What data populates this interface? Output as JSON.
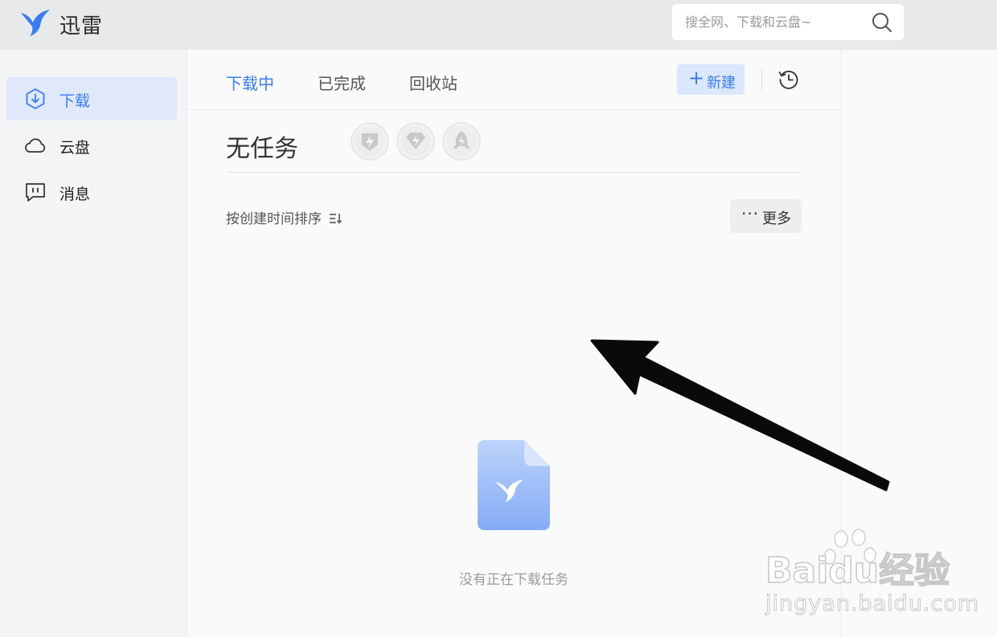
{
  "app": {
    "title": "迅雷",
    "search_placeholder": "搜全网、下载和云盘~",
    "accent_color": "#3b7cf0"
  },
  "sidebar": {
    "items": [
      {
        "label": "下载",
        "icon": "download-hexagon-icon",
        "active": true
      },
      {
        "label": "云盘",
        "icon": "cloud-icon",
        "active": false
      },
      {
        "label": "消息",
        "icon": "message-icon",
        "active": false
      }
    ]
  },
  "main": {
    "tabs": [
      {
        "label": "下载中",
        "active": true
      },
      {
        "label": "已完成",
        "active": false
      },
      {
        "label": "回收站",
        "active": false
      }
    ],
    "new_button_label": "新建",
    "status_title": "无任务",
    "badges": [
      "speed-badge-icon",
      "vip-diamond-badge-icon",
      "rocket-badge-icon"
    ],
    "sort_label": "按创建时间排序",
    "more_label": "更多",
    "empty_text": "没有正在下载任务"
  },
  "watermark": {
    "brand": "Baidu经验",
    "domain": "jingyan.baidu.com"
  }
}
